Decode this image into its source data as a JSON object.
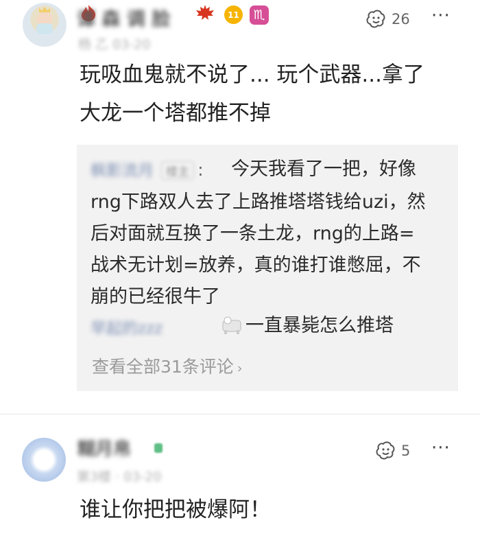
{
  "comment1": {
    "username": "谭 森 调 脸",
    "meta": "杨 乙 03-20",
    "level_badge": "11",
    "zodiac_badge": "♏",
    "like_count": "26",
    "more": "···",
    "text_lines": [
      "玩吸血鬼就不说了... 玩个武器...拿了",
      "大龙一个塔都推不掉"
    ],
    "replies": [
      {
        "name": "枫影流月",
        "tag": "楼主",
        "colon": ":",
        "lines": [
          "今天我看了一把，好像",
          "rng下路双人去了上路推塔塔钱给uzi，然",
          "后对面就互换了一条土龙，rng的上路=",
          "战术无计划=放养，真的谁打谁憋屈，不",
          "崩的已经很牛了"
        ]
      },
      {
        "name": "早起的zzz",
        "text": "一直暴毙怎么推塔"
      }
    ],
    "view_all": "查看全部31条评论",
    "view_all_arrow": "›"
  },
  "comment2": {
    "username": "糊月帛",
    "meta": "第3楼 · 03-20",
    "like_count": "5",
    "more": "···",
    "text": "谁让你把把被爆阿！"
  },
  "colors": {
    "zodiac_badge": "#d64f96",
    "level_badge": "#f6b400",
    "reply_bg": "#f2f2f2"
  }
}
